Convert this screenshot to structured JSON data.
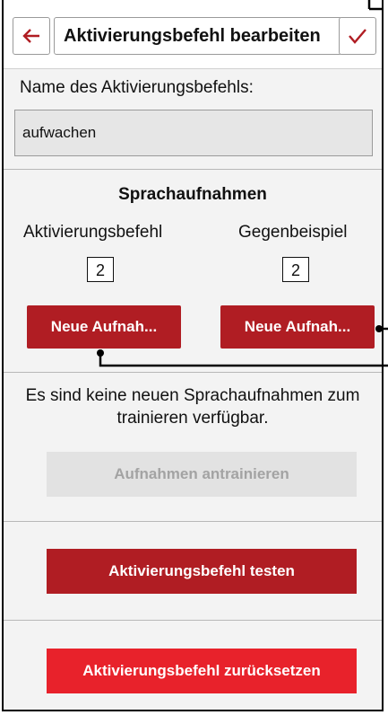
{
  "header": {
    "title": "Aktivierungsbefehl bearbeiten",
    "back_icon": "back-arrow-icon",
    "confirm_icon": "checkmark-icon"
  },
  "name_field": {
    "label": "Name des Aktivierungsbefehls:",
    "value": "aufwachen"
  },
  "recordings": {
    "section_title": "Sprachaufnahmen",
    "positive": {
      "title": "Aktivierungsbefehl",
      "count": "2",
      "button": "Neue Aufnah..."
    },
    "negative": {
      "title": "Gegenbeispiel",
      "count": "2",
      "button": "Neue Aufnah..."
    }
  },
  "training": {
    "info": "Es sind keine neuen Sprachaufnahmen zum trainieren verfügbar.",
    "button": "Aufnahmen antrainieren"
  },
  "actions": {
    "test_button": "Aktivierungsbefehl testen",
    "reset_button": "Aktivierungsbefehl zurücksetzen"
  },
  "colors": {
    "primary": "#b01d23",
    "danger": "#e8222b",
    "disabled": "#e2e2e2"
  }
}
